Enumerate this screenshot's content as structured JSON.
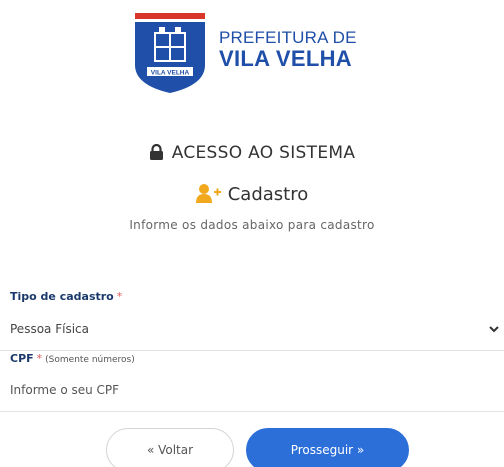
{
  "brand": {
    "line1": "PREFEITURA DE",
    "line2": "VILA VELHA",
    "crest_text": "VILA VELHA",
    "color": "#1f4fa8"
  },
  "heading": {
    "icon": "lock-icon",
    "text": "ACESSO AO SISTEMA"
  },
  "subheading": {
    "icon": "user-plus-icon",
    "text": "Cadastro",
    "icon_color": "#f2a81d"
  },
  "description": "Informe os dados abaixo para cadastro",
  "form": {
    "tipo": {
      "label": "Tipo de cadastro",
      "required_mark": "*",
      "selected": "Pessoa Física"
    },
    "cpf": {
      "label": "CPF",
      "required_mark": "*",
      "hint": "(Somente números)",
      "placeholder": "Informe o seu CPF"
    }
  },
  "buttons": {
    "back": "« Voltar",
    "next": "Prosseguir »"
  },
  "colors": {
    "primary": "#2c6fd9",
    "label": "#1b3a6b",
    "required": "#e05a5a"
  }
}
